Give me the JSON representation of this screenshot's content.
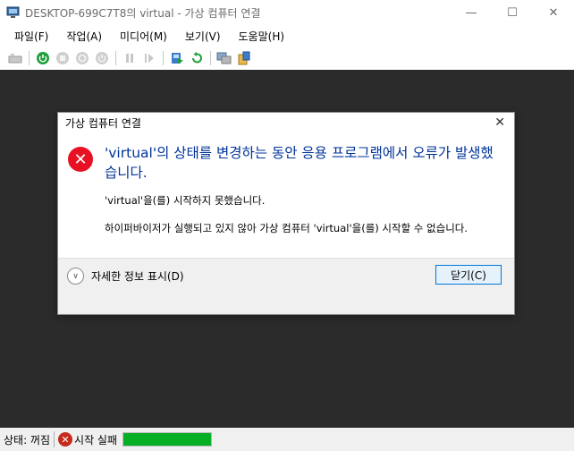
{
  "window": {
    "title": "DESKTOP-699C7T8의 virtual - 가상 컴퓨터 연결",
    "minimize": "—",
    "maximize": "☐",
    "close": "✕"
  },
  "menu": [
    {
      "label": "파일(F)"
    },
    {
      "label": "작업(A)"
    },
    {
      "label": "미디어(M)"
    },
    {
      "label": "보기(V)"
    },
    {
      "label": "도움말(H)"
    }
  ],
  "toolbar": {
    "icons": [
      "ctrl-alt-del-icon",
      "start-icon",
      "turn-off-icon",
      "shut-down-icon",
      "save-icon",
      "pause-icon",
      "reset-icon",
      "checkpoint-icon",
      "revert-icon",
      "enhanced-session-icon",
      "share-icon"
    ]
  },
  "dialog": {
    "title": "가상 컴퓨터 연결",
    "close": "✕",
    "main_instruction": "'virtual'의 상태를 변경하는 동안 응용 프로그램에서 오류가 발생했습니다.",
    "content1": "'virtual'을(를) 시작하지 못했습니다.",
    "content2": "하이퍼바이저가 실행되고 있지 않아 가상 컴퓨터 'virtual'을(를) 시작할 수 없습니다.",
    "details_label": "자세한 정보 표시(D)",
    "close_button": "닫기(C)",
    "error_glyph": "✕",
    "chevron_glyph": "∨"
  },
  "status": {
    "state": "상태: 꺼짐",
    "start_result": "시작 실패",
    "error_glyph": "✕"
  },
  "colors": {
    "vm_background": "#2b2b2b",
    "error_red": "#e81123",
    "instruction_blue": "#003399",
    "progress_green": "#06b025",
    "button_border": "#0078d7"
  }
}
